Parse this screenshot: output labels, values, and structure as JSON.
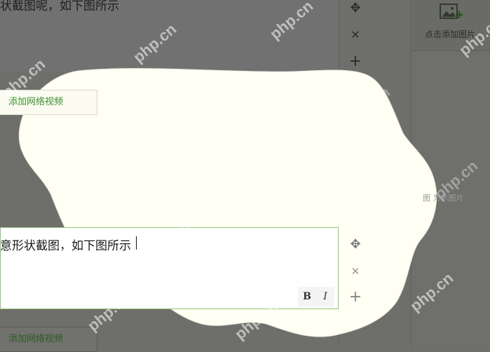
{
  "editor_top": {
    "text": "状截图呢，如下图所示"
  },
  "video_button": {
    "label": "添加网络视频"
  },
  "video_button_bottom": {
    "label": "添加网络视频"
  },
  "right_panel": {
    "add_image_label": "点击添加图片",
    "side_hint": "图 为示图片"
  },
  "active_editor": {
    "text": "意形状截图，如下图所示",
    "bold_label": "B",
    "italic_label": "I"
  },
  "watermark": {
    "text": "php.cn"
  },
  "icons": {
    "move": "move-icon",
    "close": "close-icon",
    "add": "plus-icon",
    "image": "image-add-icon"
  },
  "colors": {
    "overlay": "#6e6f6a",
    "highlight": "#fffff5",
    "editor_border": "#8cc477",
    "video_link": "#2d5c25"
  }
}
